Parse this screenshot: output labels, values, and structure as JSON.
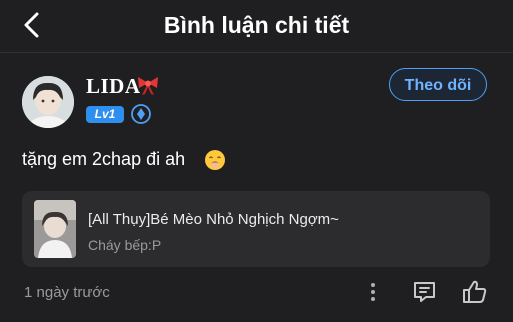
{
  "header": {
    "title": "Bình luận chi tiết",
    "back_icon": "chevron-left-icon"
  },
  "user": {
    "name": "LIDA",
    "name_decoration_icon": "ribbon-bow-icon",
    "level": "Lv1",
    "badge_icon": "diamond-badge-icon",
    "follow_label": "Theo dõi"
  },
  "comment": {
    "text": "tặng em 2chap đi ah",
    "emoji_icon": "smiling-face-icon"
  },
  "linked_story": {
    "title": "[All Thụy]Bé Mèo Nhỏ Nghịch Ngợm~",
    "subtitle": "Cháy bếp:P"
  },
  "footer": {
    "time": "1 ngày trước",
    "more_icon": "more-vertical-icon",
    "reply_icon": "reply-comment-icon",
    "like_icon": "thumbs-up-icon"
  },
  "colors": {
    "background": "#1f1f21",
    "accent": "#4e9ff5",
    "card": "#2c2c2e",
    "level_badge": "#2f8ff0"
  }
}
